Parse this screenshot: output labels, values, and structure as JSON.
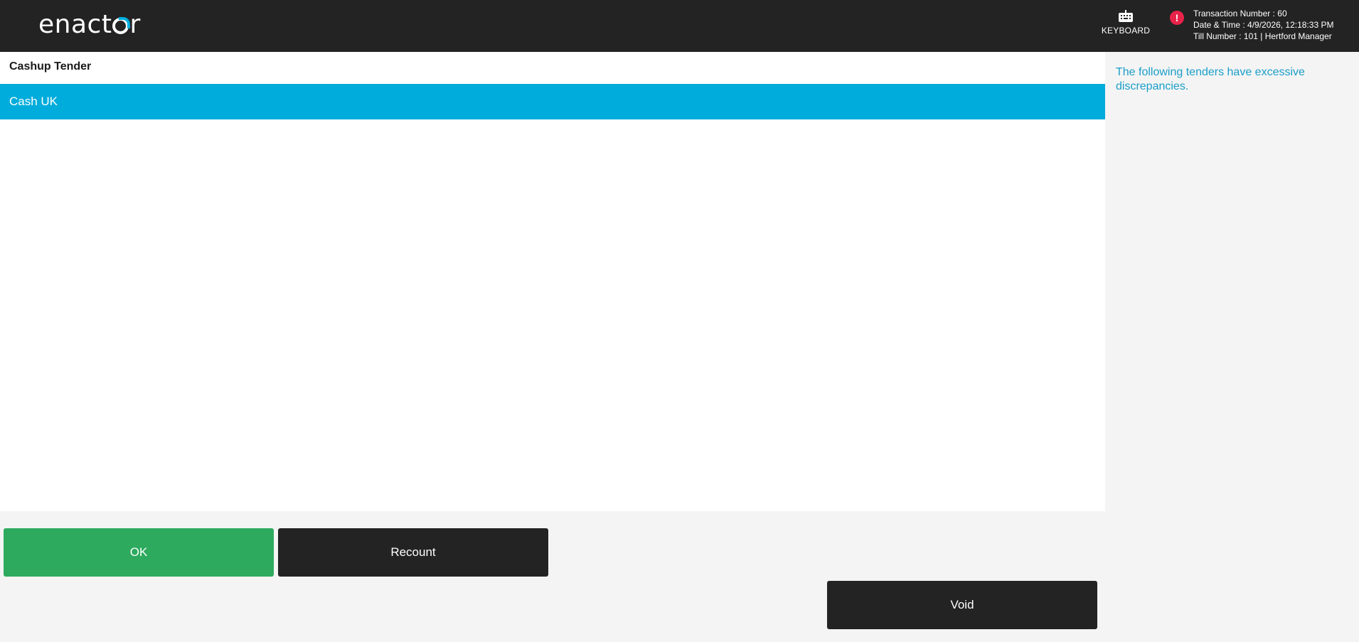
{
  "header": {
    "logo": {
      "before": "enact",
      "after": "r"
    },
    "keyboard_label": "KEYBOARD",
    "transaction_number": "Transaction Number : 60",
    "date_time": "Date & Time : 4/9/2026, 12:18:33 PM",
    "till_number": "Till Number : 101 | Hertford Manager",
    "alert_glyph": "!",
    "icons": {
      "keyboard": "keyboard-icon",
      "alert": "alert-icon"
    },
    "colors": {
      "background": "#232323",
      "alert": "#e8234a",
      "logo_accent": "#00aedf"
    }
  },
  "main": {
    "list_title": "Cashup Tender",
    "items": [
      {
        "label": "Cash UK",
        "selected": true
      }
    ],
    "colors": {
      "selected_row": "#00acdc"
    }
  },
  "side_panel": {
    "message": "The following tenders have excessive discrepancies."
  },
  "buttons": {
    "ok": "OK",
    "recount": "Recount",
    "void": "Void",
    "colors": {
      "ok": "#2daa5e",
      "dark": "#232323"
    }
  }
}
